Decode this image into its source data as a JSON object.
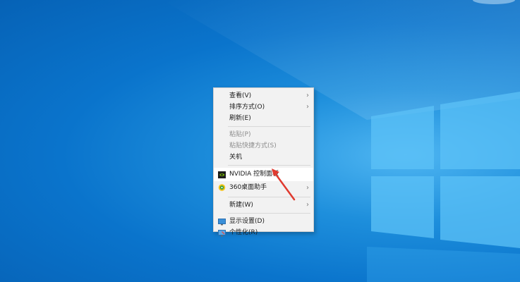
{
  "context_menu": {
    "items": [
      {
        "label": "查看(V)"
      },
      {
        "label": "排序方式(O)"
      },
      {
        "label": "刷新(E)"
      },
      {
        "label": "粘贴(P)"
      },
      {
        "label": "粘贴快捷方式(S)"
      },
      {
        "label": "关机"
      },
      {
        "label": "NVIDIA 控制面板",
        "icon": "nvidia-icon"
      },
      {
        "label": "360桌面助手",
        "icon": "360-icon"
      },
      {
        "label": "新建(W)"
      },
      {
        "label": "显示设置(D)",
        "icon": "display-icon"
      },
      {
        "label": "个性化(R)",
        "icon": "personalize-icon"
      }
    ],
    "submenu_chevron": "›"
  },
  "colors": {
    "menu_bg": "#f2f2f2",
    "highlight_bg": "#ffffff",
    "annotation_arrow": "#e03a2f",
    "wallpaper_blue": "#0a74cc"
  }
}
